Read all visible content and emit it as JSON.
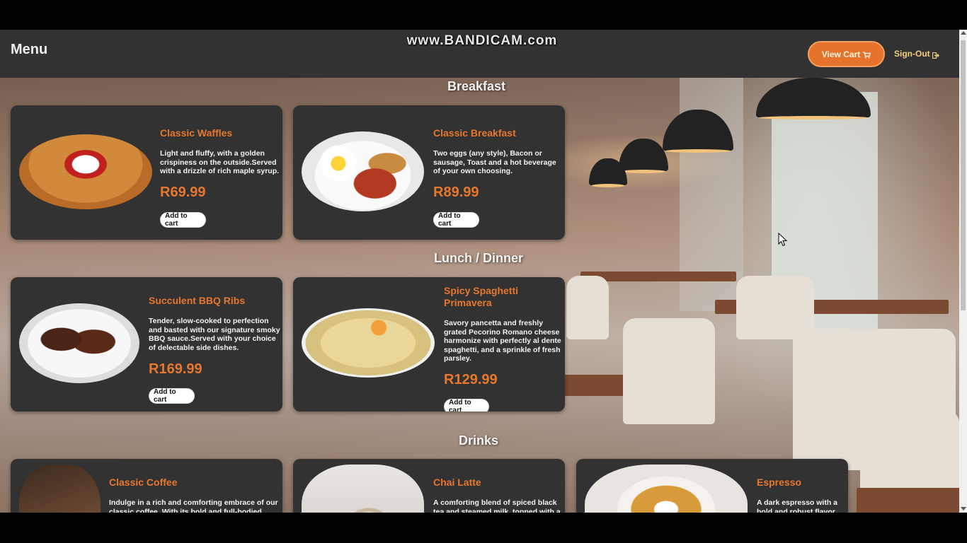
{
  "watermark": "www.BANDICAM.com",
  "navbar": {
    "brand": "Menu",
    "view_cart_label": "View Cart",
    "sign_out_label": "Sign-Out"
  },
  "sections": {
    "breakfast": "Breakfast",
    "lunch_dinner": "Lunch / Dinner",
    "drinks": "Drinks"
  },
  "items": {
    "waffles": {
      "name": "Classic Waffles",
      "description": "Light and fluffy, with a golden crispiness on the outside.Served with a drizzle of rich maple syrup.",
      "price": "R69.99",
      "button": "Add to cart"
    },
    "breakfast": {
      "name": "Classic Breakfast",
      "description": "Two eggs (any style), Bacon or sausage, Toast and a hot beverage of your own choosing.",
      "price": "R89.99",
      "button": "Add to cart"
    },
    "ribs": {
      "name": "Succulent BBQ Ribs",
      "description": "Tender, slow-cooked to perfection and basted with our signature smoky BBQ sauce.Served with your choice of delectable side dishes.",
      "price": "R169.99",
      "button": "Add to cart"
    },
    "spaghetti": {
      "name": "Spicy Spaghetti Primavera",
      "description": "Savory pancetta and freshly grated Pecorino Romano cheese harmonize with perfectly al dente spaghetti, and a sprinkle of fresh parsley.",
      "price": "R129.99",
      "button": "Add to cart"
    },
    "coffee": {
      "name": "Classic Coffee",
      "description": "Indulge in a rich and comforting embrace of our classic coffee. With its bold and full-bodied"
    },
    "chai": {
      "name": "Chai Latte",
      "description": "A comforting blend of spiced black tea and steamed milk, topped with a"
    },
    "espresso": {
      "name": "Espresso",
      "description": "A dark espresso with a bold and robust flavor"
    }
  },
  "colors": {
    "accent": "#e8772e",
    "navbar": "#323232",
    "card": "#323232",
    "sign_out": "#f3d07c"
  },
  "icons": {
    "cart": "shopping-cart-icon",
    "sign_out": "sign-out-icon",
    "cursor": "mouse-cursor-icon"
  }
}
